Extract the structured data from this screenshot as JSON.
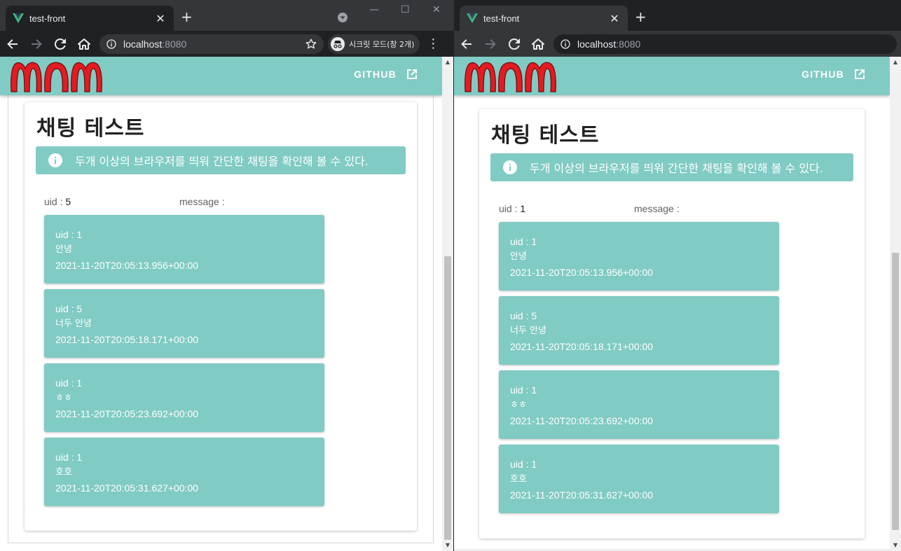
{
  "windows": [
    {
      "tab_title": "test-front",
      "url_host": "localhost",
      "url_port": ":8080",
      "incognito_label": "시크릿 모드(창 2개)",
      "nav": {
        "github": "GITHUB"
      },
      "card": {
        "title": "채팅 테스트",
        "alert": "두개 이상의 브라우저를 띄워 간단한 채팅을 확인해 볼 수 있다.",
        "uid_label": "uid : ",
        "uid_value": "5",
        "message_label": "message :"
      },
      "messages": [
        {
          "uid": "uid : 1",
          "text": "안녕",
          "time": "2021-11-20T20:05:13.956+00:00"
        },
        {
          "uid": "uid : 5",
          "text": "너두 안녕",
          "time": "2021-11-20T20:05:18.171+00:00"
        },
        {
          "uid": "uid : 1",
          "text": "ㅎㅎ",
          "time": "2021-11-20T20:05:23.692+00:00"
        },
        {
          "uid": "uid : 1",
          "text": "호호",
          "time": "2021-11-20T20:05:31.627+00:00"
        }
      ]
    },
    {
      "tab_title": "test-front",
      "url_host": "localhost",
      "url_port": ":8080",
      "nav": {
        "github": "GITHUB"
      },
      "card": {
        "title": "채팅 테스트",
        "alert": "두개 이상의 브라우저를 띄워 간단한 채팅을 확인해 볼 수 있다.",
        "uid_label": "uid : ",
        "uid_value": "1",
        "message_label": "message :"
      },
      "messages": [
        {
          "uid": "uid : 1",
          "text": "안녕",
          "time": "2021-11-20T20:05:13.956+00:00"
        },
        {
          "uid": "uid : 5",
          "text": "너두 안녕",
          "time": "2021-11-20T20:05:18.171+00:00"
        },
        {
          "uid": "uid : 1",
          "text": "ㅎㅎ",
          "time": "2021-11-20T20:05:23.692+00:00"
        },
        {
          "uid": "uid : 1",
          "text": "호호",
          "time": "2021-11-20T20:05:31.627+00:00"
        }
      ]
    }
  ],
  "icons": [
    "vue-logo-icon",
    "close-icon",
    "plus-icon",
    "tab-search-icon",
    "back-arrow-icon",
    "forward-arrow-icon",
    "reload-icon",
    "home-icon",
    "info-icon",
    "star-icon",
    "incognito-icon",
    "more-vert-icon",
    "open-in-new-icon",
    "info-circle-icon"
  ],
  "colors": {
    "teal": "#80cbc4",
    "logo_red": "#e31b23",
    "chrome_dark": "#202124",
    "chrome_mid": "#35363a"
  }
}
